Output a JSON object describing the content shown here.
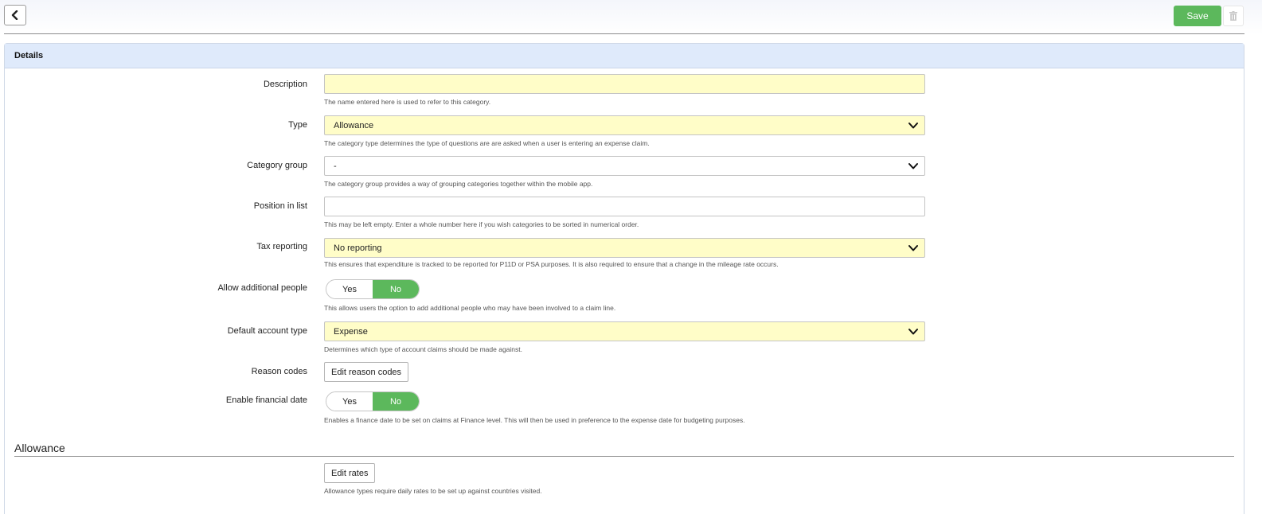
{
  "toolbar": {
    "back_icon": "chevron-left-icon",
    "save_label": "Save",
    "delete_icon": "trash-icon",
    "save_color": "#5cb85c"
  },
  "panel": {
    "title": "Details"
  },
  "form": {
    "description": {
      "label": "Description",
      "value": "",
      "hint": "The name entered here is used to refer to this category."
    },
    "type": {
      "label": "Type",
      "value": "Allowance",
      "hint": "The category type determines the type of questions are are asked when a user is entering an expense claim."
    },
    "category_group": {
      "label": "Category group",
      "value": "-",
      "hint": "The category group provides a way of grouping categories together within the mobile app."
    },
    "position": {
      "label": "Position in list",
      "value": "",
      "hint": "This may be left empty. Enter a whole number here if you wish categories to be sorted in numerical order."
    },
    "tax_reporting": {
      "label": "Tax reporting",
      "value": "No reporting",
      "hint": "This ensures that expenditure is tracked to be reported for P11D or PSA purposes. It is also required to ensure that a change in the mileage rate occurs."
    },
    "additional_people": {
      "label": "Allow additional people",
      "yes": "Yes",
      "no": "No",
      "selected": "No",
      "hint": "This allows users the option to add additional people who may have been involved to a claim line."
    },
    "default_account": {
      "label": "Default account type",
      "value": "Expense",
      "hint": "Determines which type of account claims should be made against."
    },
    "reason_codes": {
      "label": "Reason codes",
      "button": "Edit reason codes"
    },
    "financial_date": {
      "label": "Enable financial date",
      "yes": "Yes",
      "no": "No",
      "selected": "No",
      "hint": "Enables a finance date to be set on claims at Finance level. This will then be used in preference to the expense date for budgeting purposes."
    }
  },
  "allowance": {
    "title": "Allowance",
    "button": "Edit rates",
    "hint": "Allowance types require daily rates to be set up against countries visited."
  },
  "colors": {
    "required_field": "#fffdc8",
    "toggle_on": "#5cb85c",
    "header_bg": "#dfeafb"
  }
}
